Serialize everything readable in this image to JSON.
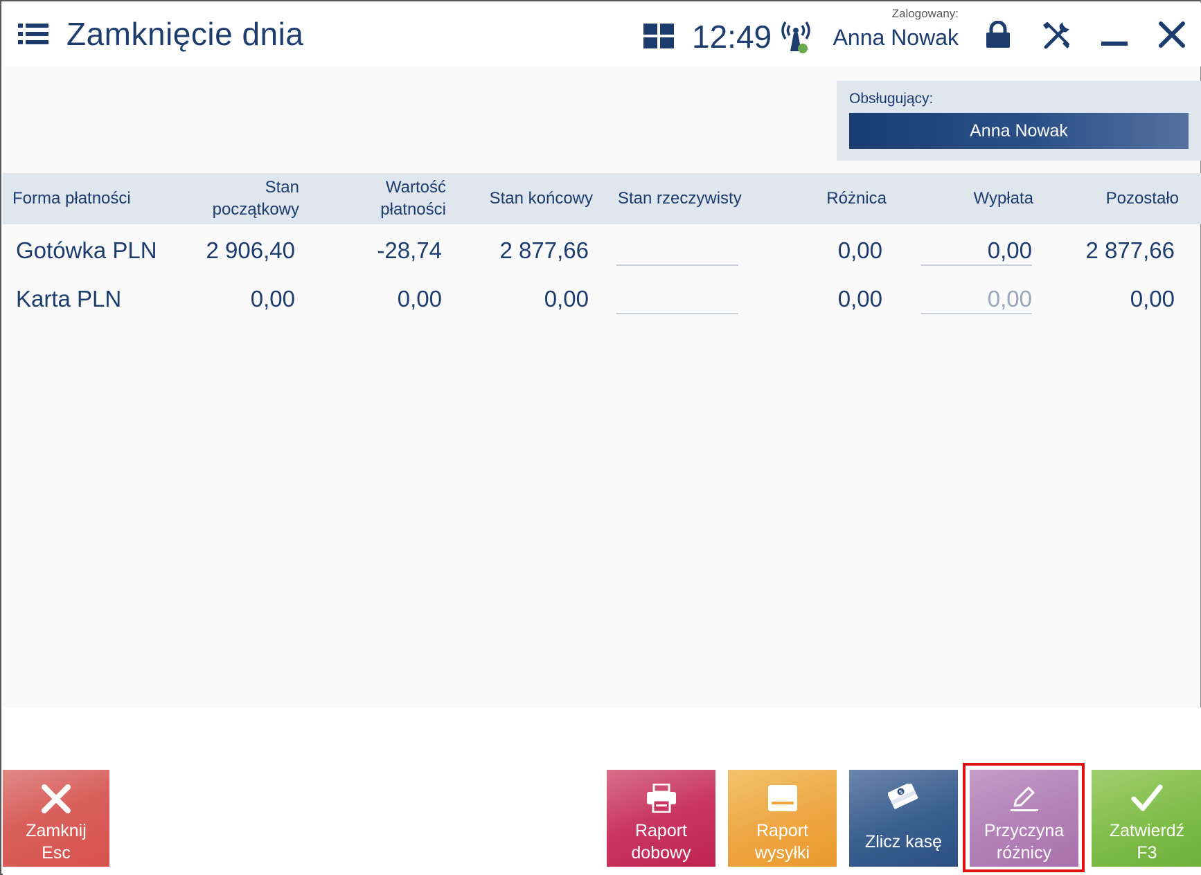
{
  "header": {
    "title": "Zamknięcie dnia",
    "clock": "12:49",
    "logged_label": "Zalogowany:",
    "logged_user": "Anna Nowak"
  },
  "cashier": {
    "label": "Obsługujący:",
    "value": "Anna Nowak"
  },
  "table": {
    "columns": [
      [
        "Forma płatności"
      ],
      [
        "Stan",
        "początkowy"
      ],
      [
        "Wartość",
        "płatności"
      ],
      [
        "Stan końcowy"
      ],
      [
        "Stan rzeczywisty"
      ],
      [
        "Różnica"
      ],
      [
        "Wypłata"
      ],
      [
        "Pozostało"
      ]
    ],
    "rows": [
      {
        "name": "Gotówka PLN",
        "start": "2 906,40",
        "payments": "-28,74",
        "end": "2 877,66",
        "actual": "",
        "difference": "0,00",
        "payout": "0,00",
        "remaining": "2 877,66"
      },
      {
        "name": "Karta PLN",
        "start": "0,00",
        "payments": "0,00",
        "end": "0,00",
        "actual": "",
        "difference": "0,00",
        "payout": "0,00",
        "remaining": "0,00"
      }
    ]
  },
  "buttons": {
    "close": [
      "Zamknij",
      "Esc"
    ],
    "daily_report": [
      "Raport",
      "dobowy"
    ],
    "shipping_report": [
      "Raport",
      "wysyłki"
    ],
    "count_cash": [
      "Zlicz kasę"
    ],
    "difference_reason": [
      "Przyczyna",
      "różnicy"
    ],
    "confirm": [
      "Zatwierdź",
      "F3"
    ]
  },
  "colors": {
    "primary": "#1d3c6e",
    "header_band": "#e0e6ee",
    "highlight": "#e01010",
    "online_dot": "#6aa84f"
  },
  "icons": [
    "menu-icon",
    "grid-icon",
    "signal-icon",
    "lock-icon",
    "tools-icon",
    "minimize-icon",
    "close-icon",
    "x-icon",
    "printer-icon",
    "card-icon",
    "cash-stack-icon",
    "pencil-icon",
    "checkmark-icon"
  ]
}
